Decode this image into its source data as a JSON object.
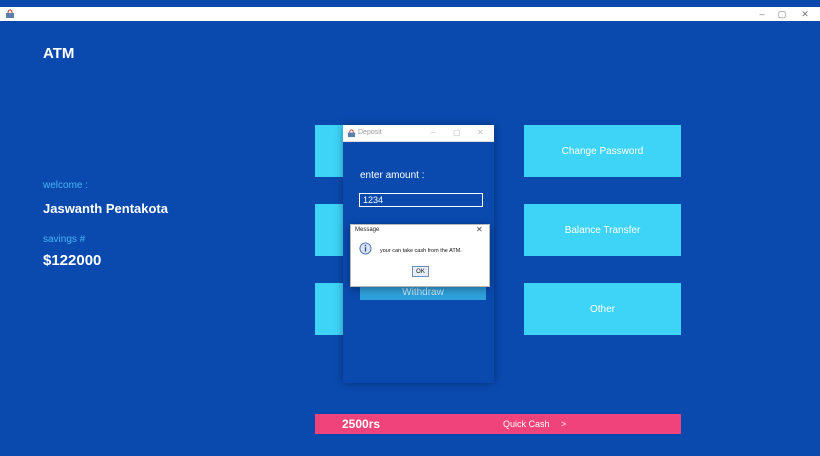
{
  "window": {
    "minimize_icon": "minimize-icon",
    "maximize_icon": "maximize-icon",
    "close_icon": "close-icon",
    "minimize": "–",
    "maximize": "▢",
    "close": "✕"
  },
  "colors": {
    "background": "#0a4aae",
    "tile": "#3dd4f7",
    "quick_cash": "#f0427b",
    "label_accent": "#47b3f5"
  },
  "header": {
    "title": "ATM"
  },
  "user": {
    "welcome_label": "welcome :",
    "name": "Jaswanth Pentakota",
    "savings_label": "savings #",
    "balance": "$122000"
  },
  "tiles": {
    "change_password": "Change Password",
    "balance_transfer": "Balance Transfer",
    "other": "Other"
  },
  "quick_cash": {
    "amount": "2500rs",
    "label": "Quick Cash",
    "arrow": ">"
  },
  "deposit_dialog": {
    "title": "Deposit",
    "enter_amount_label": "enter amount :",
    "amount_value": "1234",
    "withdraw_label": "Withdraw"
  },
  "message_dialog": {
    "title": "Message",
    "close": "✕",
    "info_icon": "info-icon",
    "text": "your can take cash from the ATM.",
    "ok_label": "OK"
  }
}
